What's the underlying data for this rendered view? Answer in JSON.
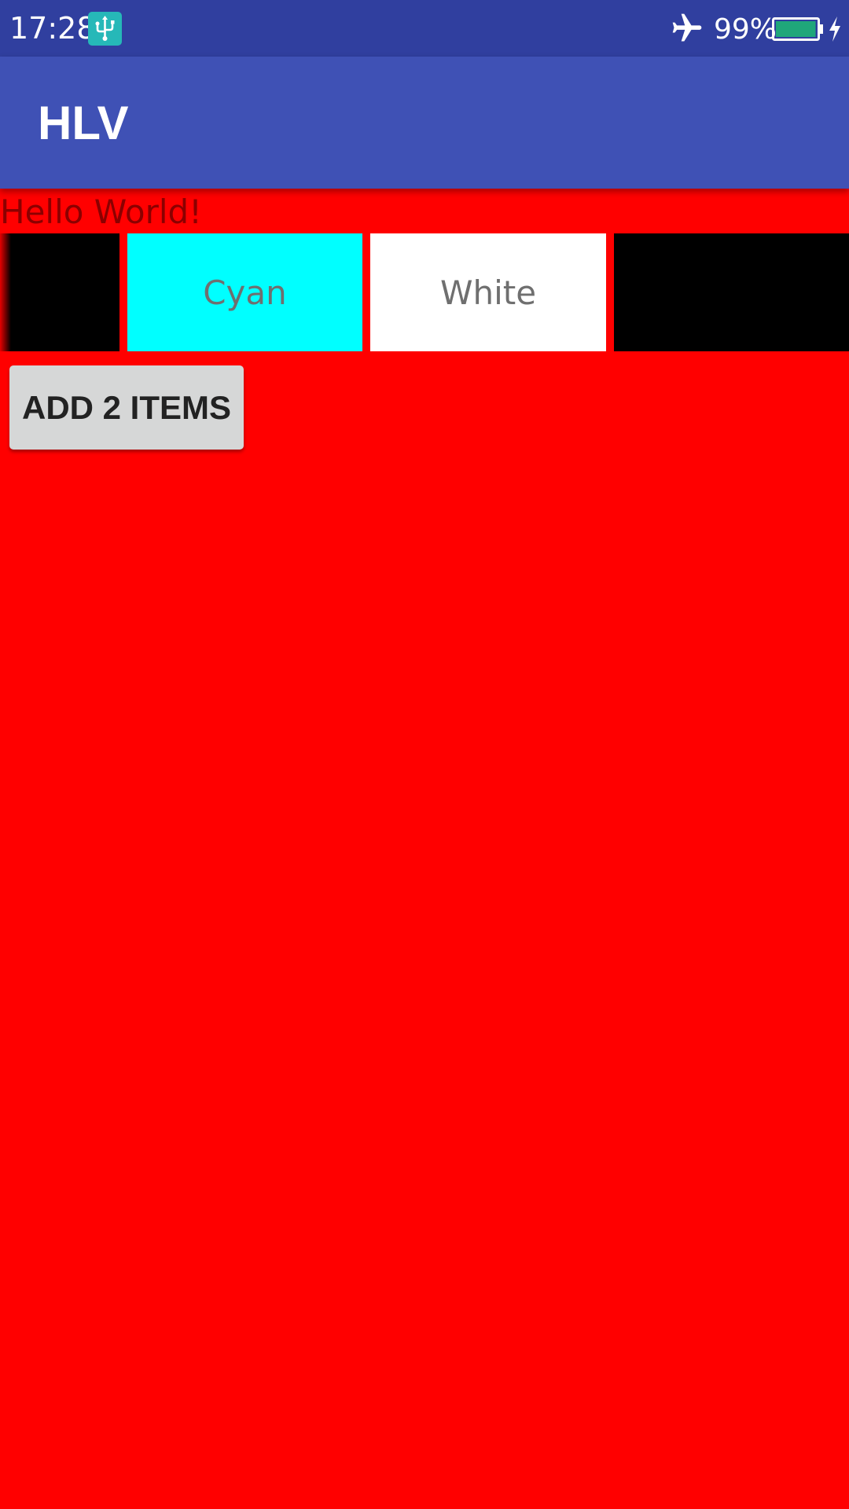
{
  "status_bar": {
    "time": "17:28",
    "usb_icon": "usb-icon",
    "airplane_icon": "airplane-mode-icon",
    "battery_percent": "99%",
    "battery_level": 0.99,
    "charging_icon": "charging-bolt-icon",
    "background": "#303f9f"
  },
  "app_bar": {
    "title": "HLV",
    "background": "#3f51b5"
  },
  "content": {
    "background": "#ff0000",
    "hello_text": "Hello World!",
    "list_items": [
      {
        "label": "",
        "color": "#000000"
      },
      {
        "label": "Cyan",
        "color": "#00ffff"
      },
      {
        "label": "White",
        "color": "#ffffff"
      },
      {
        "label": "",
        "color": "#000000"
      }
    ],
    "add_button_label": "ADD 2 ITEMS"
  }
}
